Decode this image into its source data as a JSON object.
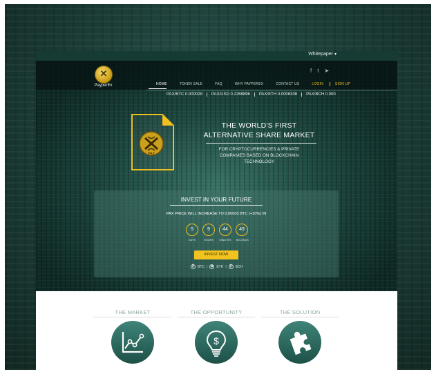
{
  "whitepaper": {
    "label": "Whitepaper"
  },
  "logo": {
    "text": "PayperEx"
  },
  "nav": {
    "items": [
      {
        "label": "HOME"
      },
      {
        "label": "TOKEN SALE"
      },
      {
        "label": "FAQ"
      },
      {
        "label": "WHY PAYPEREX"
      },
      {
        "label": "CONTACT US"
      },
      {
        "label": "LOGIN"
      },
      {
        "label": "SIGN UP"
      }
    ]
  },
  "social": {
    "facebook": "f",
    "twitter": "t",
    "telegram": "➤"
  },
  "ticker": [
    "PAX/BTC 0.000028",
    "PAX/USD 0.2268896",
    "PAX/ETH 0.0006308",
    "PAX/BCH 0.000"
  ],
  "hero": {
    "doc_label": "PAX",
    "headline_1": "THE WORLD'S FIRST",
    "headline_2": "ALTERNATIVE SHARE MARKET",
    "subhead_1": "FOR CRYPTOCURRENCIES & PRIVATE",
    "subhead_2": "COMPANIES BASED ON BLOCKCHAIN",
    "subhead_3": "TECHNOLOGY"
  },
  "invest": {
    "title": "INVEST IN YOUR FUTURE",
    "note": "PAX PRICE WILL INCREASE TO 0.00003 BTC (+10%) IN",
    "countdown": [
      {
        "value": "5",
        "label": "DAYS"
      },
      {
        "value": "9",
        "label": "HOURS"
      },
      {
        "value": "44",
        "label": "MINUTES"
      },
      {
        "value": "49",
        "label": "SECONDS"
      }
    ],
    "button": "INVEST NOW",
    "currencies": [
      "BTC",
      "ETH",
      "BCH"
    ]
  },
  "sections": [
    {
      "title": "THE MARKET",
      "icon": "line-chart-icon"
    },
    {
      "title": "THE OPPORTUNITY",
      "icon": "lightbulb-dollar-icon"
    },
    {
      "title": "THE SOLUTION",
      "icon": "puzzle-piece-icon"
    }
  ],
  "colors": {
    "accent": "#f2c21f",
    "teal": "#2d6b61",
    "section_title": "#8aa6a1"
  }
}
